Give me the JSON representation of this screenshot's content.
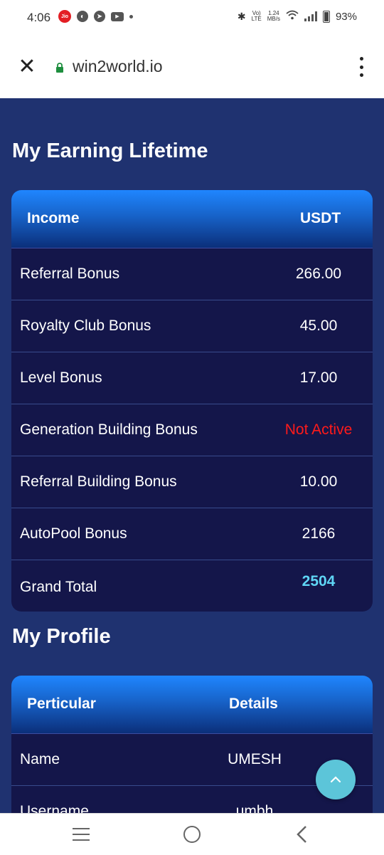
{
  "status": {
    "time": "4:06",
    "jio": "Jio",
    "net_speed_top": "1.24",
    "net_speed_bottom": "MB/s",
    "volte_top": "Vo)",
    "volte_bottom": "LTE",
    "battery": "93%"
  },
  "browser": {
    "url": "win2world.io"
  },
  "earnings": {
    "title": "My Earning Lifetime",
    "col_income": "Income",
    "col_usdt": "USDT",
    "rows": [
      {
        "label": "Referral Bonus",
        "value": "266.00"
      },
      {
        "label": "Royalty Club Bonus",
        "value": "45.00"
      },
      {
        "label": "Level Bonus",
        "value": "17.00"
      },
      {
        "label": "Generation Building Bonus",
        "value": "Not Active"
      },
      {
        "label": "Referral Building Bonus",
        "value": "10.00"
      },
      {
        "label": "AutoPool Bonus",
        "value": "2166"
      },
      {
        "label": "Grand Total",
        "value": "2504"
      }
    ]
  },
  "profile": {
    "title": "My Profile",
    "col_particular": "Perticular",
    "col_details": "Details",
    "rows": [
      {
        "label": "Name",
        "value": "UMESH"
      },
      {
        "label": "Username",
        "value": "umbh"
      }
    ]
  },
  "colors": {
    "background": "#1f3270",
    "table_bg": "#14164a",
    "header_gradient_top": "#1f86ff",
    "not_active": "#ff1a1a",
    "grand_total": "#5fd6f5",
    "scroll_button": "#5cc5d9"
  }
}
